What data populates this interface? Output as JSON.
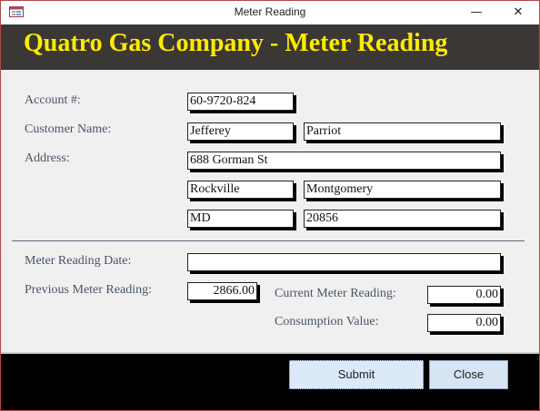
{
  "window": {
    "title": "Meter Reading",
    "icons": {
      "app": "form-window-icon",
      "minimize": "minimize-icon",
      "close": "close-icon"
    },
    "minimize_glyph": "—",
    "close_glyph": "✕"
  },
  "header": {
    "title": "Quatro Gas Company - Meter Reading"
  },
  "form": {
    "account_label": "Account #:",
    "account_value": "60-9720-824",
    "customer_name_label": "Customer Name:",
    "first_name": "Jefferey",
    "last_name": "Parriot",
    "address_label": "Address:",
    "address": "688 Gorman St",
    "city": "Rockville",
    "county": "Montgomery",
    "state": "MD",
    "zip": "20856",
    "meter_reading_date_label": "Meter Reading Date:",
    "meter_reading_date": "",
    "previous_reading_label": "Previous Meter Reading:",
    "previous_reading": "2866.00",
    "current_reading_label": "Current Meter Reading:",
    "current_reading": "0.00",
    "consumption_label": "Consumption Value:",
    "consumption": "0.00"
  },
  "buttons": {
    "submit": "Submit",
    "close": "Close"
  },
  "colors": {
    "header_bg": "#3a3735",
    "header_text": "#ffea00",
    "label_text": "#4a5568",
    "footer_bg": "#000000"
  }
}
